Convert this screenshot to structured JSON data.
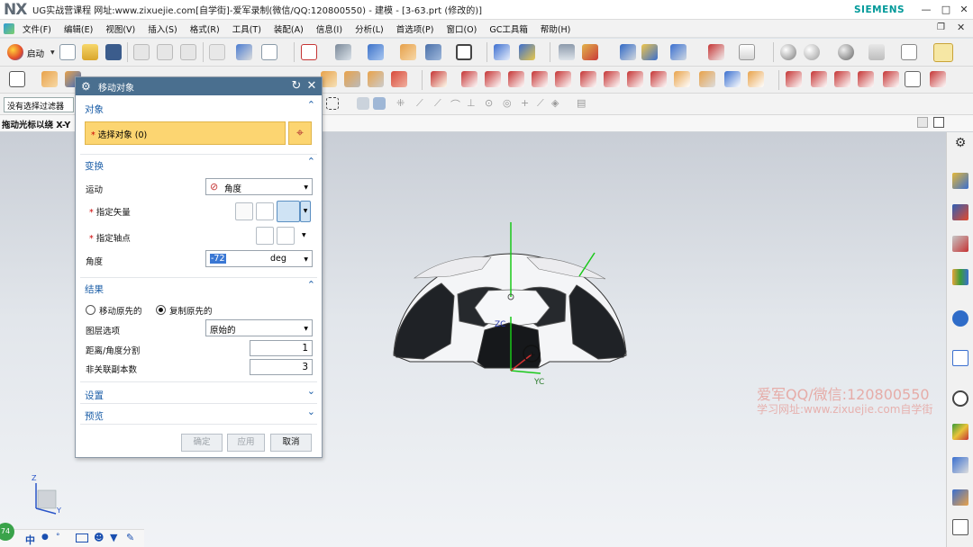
{
  "window": {
    "logo": "NX",
    "title": "UG实战营课程 网址:www.zixuejie.com[自学街]-爱军录制(微信/QQ:120800550) - 建模 - [3-63.prt (修改的)]",
    "brand": "SIEMENS",
    "controls": [
      "—",
      "□",
      "✕"
    ]
  },
  "menu": {
    "items": [
      "文件(F)",
      "编辑(E)",
      "视图(V)",
      "插入(S)",
      "格式(R)",
      "工具(T)",
      "装配(A)",
      "信息(I)",
      "分析(L)",
      "首选项(P)",
      "窗口(O)",
      "GC工具箱",
      "帮助(H)"
    ]
  },
  "toolbar": {
    "start_label": "启动",
    "filter_label": "没有选择过滤器"
  },
  "hint": {
    "text": "拖动光标以绕 X-Y"
  },
  "dialog": {
    "title": "移动对象",
    "sections": {
      "object": {
        "header": "对象",
        "select_label": "选择对象 (0)"
      },
      "transform": {
        "header": "变换",
        "motion_label": "运动",
        "motion_value": "角度",
        "vector_label": "指定矢量",
        "pivot_label": "指定轴点",
        "angle_label": "角度",
        "angle_value": "-72",
        "angle_unit": "deg"
      },
      "result": {
        "header": "结果",
        "move_original": "移动原先的",
        "copy_original": "复制原先的",
        "copy_selected": true,
        "layer_label": "图层选项",
        "layer_value": "原始的",
        "divisions_label": "距离/角度分割",
        "divisions_value": "1",
        "copies_label": "非关联副本数",
        "copies_value": "3"
      },
      "settings": {
        "header": "设置"
      },
      "preview": {
        "header": "预览"
      }
    },
    "buttons": {
      "ok": "确定",
      "apply": "应用",
      "cancel": "取消"
    }
  },
  "viewport": {
    "axis_labels": {
      "zc": "ZC",
      "yc": "YC"
    },
    "triad_labels": {
      "z": "Z",
      "y": "Y"
    },
    "watermark_line1": "爱军QQ/微信:120800550",
    "watermark_line2": "学习网址:www.zixuejie.com自学街"
  },
  "statusbar": {
    "badge": "74",
    "ime": "中"
  },
  "colors": {
    "accent": "#4a6f8f",
    "selection_highlight": "#fcd571",
    "section_header": "#1d5fa8",
    "axis_green": "#19c819"
  }
}
